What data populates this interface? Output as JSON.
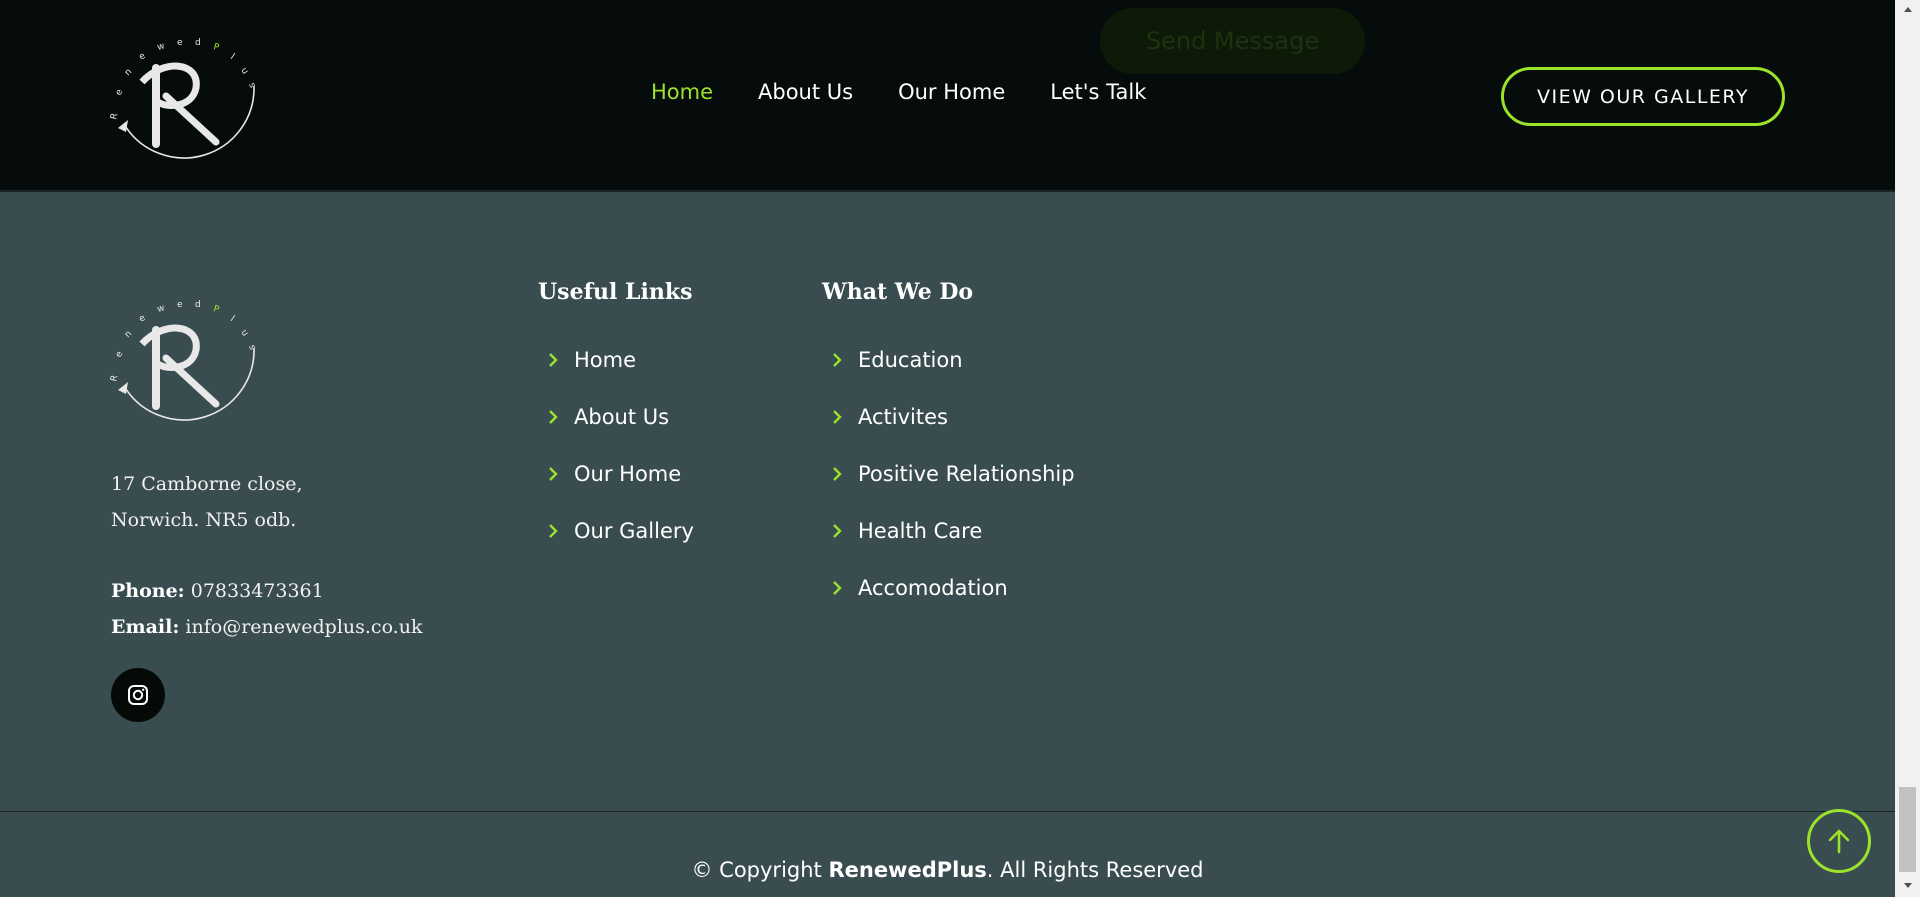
{
  "brand": {
    "name": "RenewedPlus",
    "logo_letters": "Renewed",
    "logo_accent": "P",
    "logo_tail": "lus",
    "monogram": "R",
    "accent_color": "#9be22a"
  },
  "header": {
    "ghost_button": "Send Message",
    "nav": [
      {
        "label": "Home",
        "active": true
      },
      {
        "label": "About Us",
        "active": false
      },
      {
        "label": "Our Home",
        "active": false
      },
      {
        "label": "Let's Talk",
        "active": false
      }
    ],
    "cta": "VIEW OUR GALLERY"
  },
  "footer": {
    "address_line1": "17 Camborne close,",
    "address_line2": "Norwich. NR5 odb.",
    "phone_label": "Phone:",
    "phone": "07833473361",
    "email_label": "Email:",
    "email": "info@renewedplus.co.uk",
    "social_icon": "instagram-icon",
    "useful_links": {
      "title": "Useful Links",
      "items": [
        "Home",
        "About Us",
        "Our Home",
        "Our Gallery"
      ]
    },
    "what_we_do": {
      "title": "What We Do",
      "items": [
        "Education",
        "Activites",
        "Positive Relationship",
        "Health Care",
        "Accomodation"
      ]
    },
    "copyright_prefix": "© Copyright ",
    "copyright_brand": "RenewedPlus",
    "copyright_suffix": ". All Rights Reserved"
  }
}
